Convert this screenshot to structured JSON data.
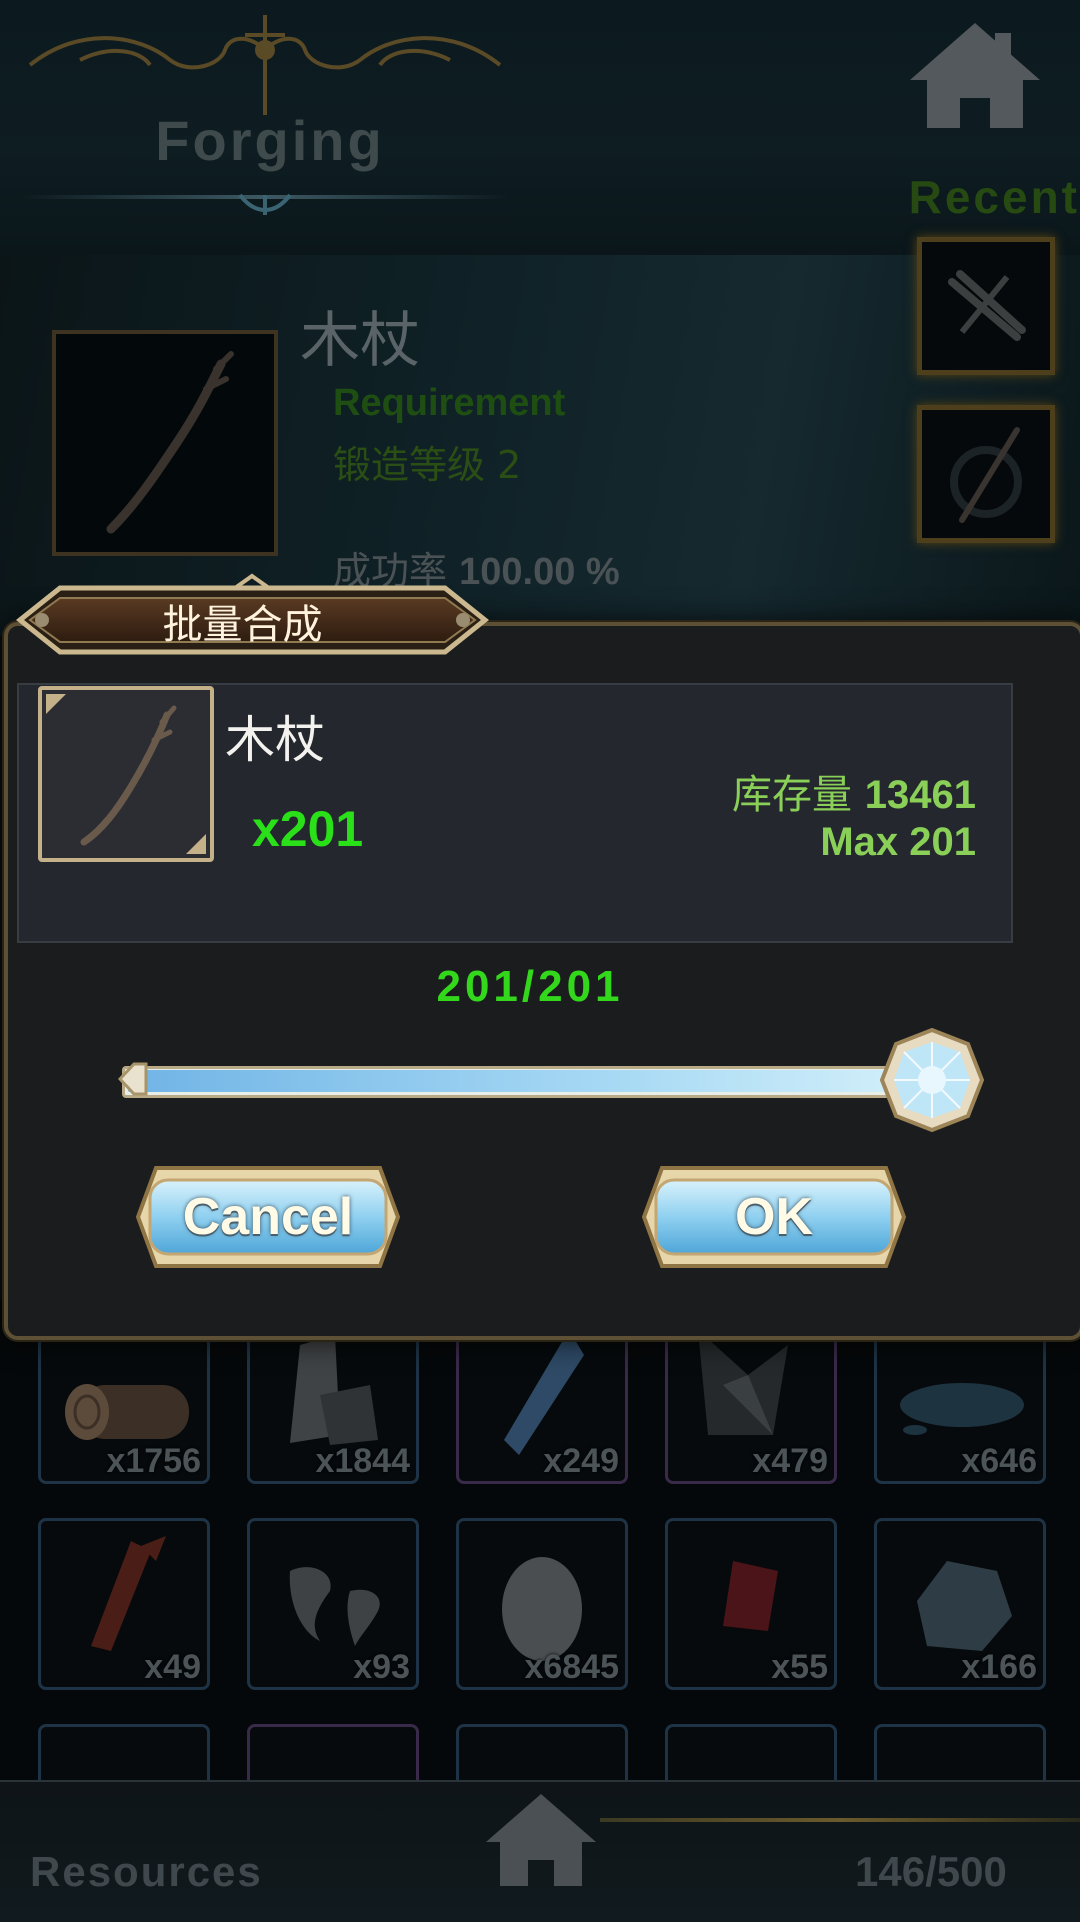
{
  "header": {
    "title": "Forging",
    "recent_label": "Recent"
  },
  "selected_item": {
    "name": "木杖",
    "requirement_label": "Requirement",
    "requirement_value": "锻造等级 2",
    "success_rate_label": "成功率",
    "success_rate_value": "100.00 %"
  },
  "modal": {
    "title": "批量合成",
    "item_name": "木杖",
    "quantity": "x201",
    "stock_label": "库存量",
    "stock_value": "13461",
    "max_label": "Max",
    "max_value": "201",
    "progress_text": "201/201",
    "slider_fraction": 1.0,
    "cancel_label": "Cancel",
    "ok_label": "OK"
  },
  "resources": {
    "label": "Resources",
    "count": "146/500",
    "row1": [
      "x1756",
      "x1844",
      "x249",
      "x479",
      "x646"
    ],
    "row2": [
      "x49",
      "x93",
      "x6845",
      "x55",
      "x166"
    ]
  },
  "colors": {
    "accent_green": "#2ae018",
    "stock_green": "#8ad058",
    "frame_gold": "#c4b18a",
    "button_blue": "#8fd0f0"
  }
}
